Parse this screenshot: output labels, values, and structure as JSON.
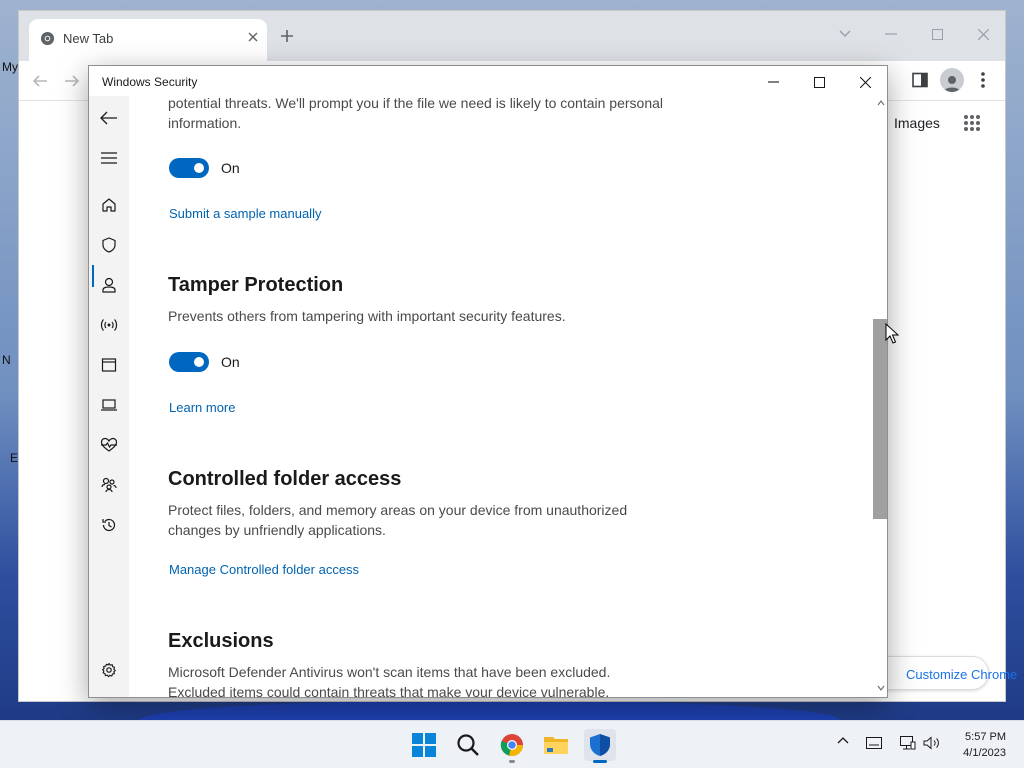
{
  "browser": {
    "tab_title": "New Tab",
    "images_link": "Images",
    "customize_label": "Customize Chrome"
  },
  "desktop": {
    "labels": [
      "My",
      "N",
      "E"
    ]
  },
  "security_window": {
    "title": "Windows Security",
    "cloud_section": {
      "description": "potential threats. We'll prompt you if the file we need is likely to contain personal information.",
      "toggle_label": "On",
      "link": "Submit a sample manually"
    },
    "tamper_section": {
      "heading": "Tamper Protection",
      "description": "Prevents others from tampering with important security features.",
      "toggle_label": "On",
      "link": "Learn more"
    },
    "cfa_section": {
      "heading": "Controlled folder access",
      "description": "Protect files, folders, and memory areas on your device from unauthorized changes by unfriendly applications.",
      "link": "Manage Controlled folder access"
    },
    "exclusions_section": {
      "heading": "Exclusions",
      "description": "Microsoft Defender Antivirus won't scan items that have been excluded. Excluded items could contain threats that make your device vulnerable."
    },
    "nav_icons": [
      "back-icon",
      "menu-icon",
      "home-icon",
      "shield-icon",
      "account-icon",
      "firewall-icon",
      "app-browser-icon",
      "device-icon",
      "health-icon",
      "family-icon",
      "history-icon",
      "settings-icon"
    ]
  },
  "taskbar": {
    "time": "5:57 PM",
    "date": "4/1/2023",
    "apps": [
      "windows-start-icon",
      "search-icon",
      "chrome-icon",
      "file-explorer-icon",
      "windows-security-icon"
    ]
  },
  "colors": {
    "accent": "#0067c0",
    "link": "#0063b1"
  }
}
